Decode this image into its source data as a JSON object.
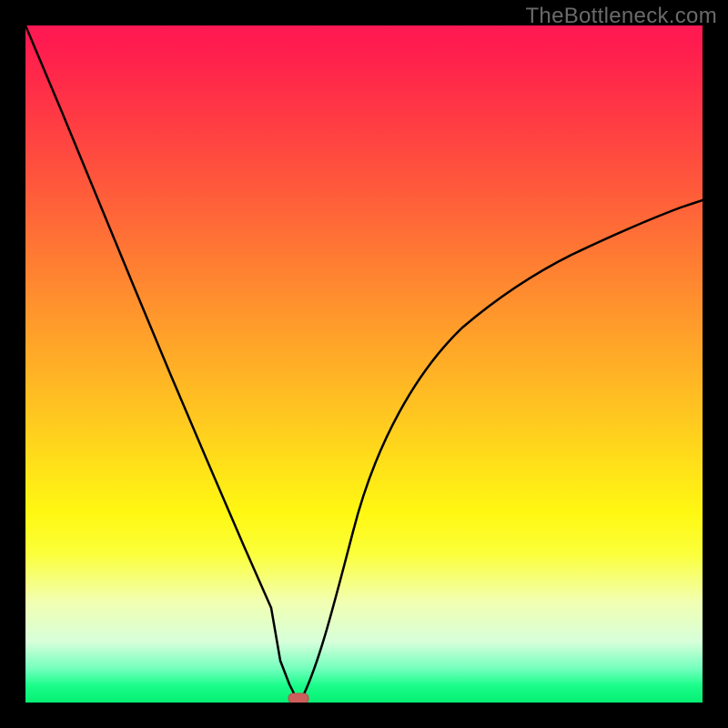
{
  "watermark": "TheBottleneck.com",
  "colors": {
    "background": "#000000",
    "gradient_top": "#ff1952",
    "gradient_mid": "#ffe418",
    "gradient_bottom": "#05ef73",
    "curve": "#000000",
    "marker": "#cc5f5c"
  },
  "chart_data": {
    "type": "line",
    "title": "",
    "xlabel": "",
    "ylabel": "",
    "xlim": [
      0,
      100
    ],
    "ylim": [
      0,
      100
    ],
    "x": [
      0,
      5,
      10,
      15,
      20,
      25,
      30,
      35,
      37,
      39,
      40,
      42,
      45,
      50,
      55,
      60,
      65,
      70,
      75,
      80,
      85,
      90,
      95,
      100
    ],
    "values": [
      100,
      87,
      74,
      61,
      48,
      36,
      23,
      10,
      4,
      1,
      0,
      3,
      11,
      25,
      37,
      47,
      55,
      61,
      66,
      70,
      73,
      76,
      78,
      80
    ],
    "annotations": [
      {
        "name": "min-marker",
        "x": 40,
        "y": 0
      }
    ],
    "legend": [],
    "grid": false
  }
}
